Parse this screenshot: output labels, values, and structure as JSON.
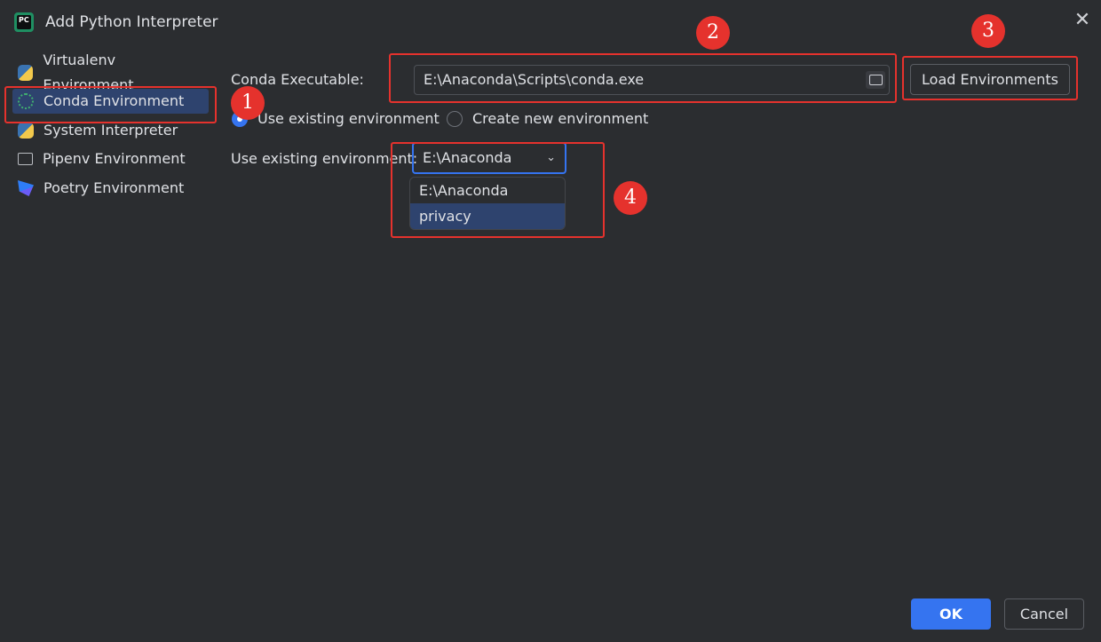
{
  "window": {
    "title": "Add Python Interpreter",
    "app_icon_text": "PC",
    "close_symbol": "✕"
  },
  "sidebar": {
    "items": [
      {
        "label": "Virtualenv Environment",
        "icon": "python-icon"
      },
      {
        "label": "Conda Environment",
        "icon": "conda-icon",
        "selected": true
      },
      {
        "label": "System Interpreter",
        "icon": "python-icon"
      },
      {
        "label": "Pipenv Environment",
        "icon": "folder-icon"
      },
      {
        "label": "Poetry Environment",
        "icon": "poetry-icon"
      }
    ]
  },
  "form": {
    "conda_label": "Conda Executable:",
    "conda_path": "E:\\Anaconda\\Scripts\\conda.exe",
    "load_button": "Load Environments",
    "radio_existing": "Use existing environment",
    "radio_new": "Create new environment",
    "existing_label": "Use existing environment:",
    "combo_value": "E:\\Anaconda",
    "chevron": "⌄",
    "options": [
      "E:\\Anaconda",
      "privacy"
    ]
  },
  "annotations": [
    "1",
    "2",
    "3",
    "4"
  ],
  "footer": {
    "ok": "OK",
    "cancel": "Cancel"
  },
  "colors": {
    "accent": "#3574f0",
    "annotation": "#e5322d",
    "background": "#2b2d30"
  }
}
